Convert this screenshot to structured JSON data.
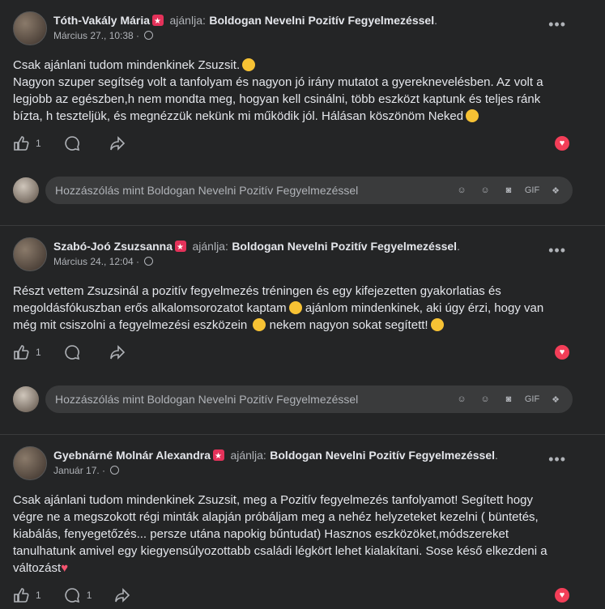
{
  "placeholder": "Hozzászólás mint Boldogan Nevelni Pozitív Fegyelmezéssel",
  "recommends": "ajánlja:",
  "posts": [
    {
      "author": "Tóth-Vakály Mária",
      "page": "Boldogan Nevelni Pozitív Fegyelmezéssel",
      "date": "Március 27., 10:38",
      "body": "Csak ajánlani tudom mindenkinek Zsuzsit.",
      "body2": "Nagyon szuper segítség volt a tanfolyam és nagyon jó irány mutatot a gyereknevelésben. Az volt a legjobb az egészben,h nem mondta meg, hogyan kell csinálni, több eszközt kaptunk és teljes ránk bízta, h teszteljük, és megnézzük nekünk mi működik jól. Hálásan köszönöm Neked",
      "likes": "1",
      "comments": ""
    },
    {
      "author": "Szabó-Joó Zsuzsanna",
      "page": "Boldogan Nevelni Pozitív Fegyelmezéssel",
      "date": "Március 24., 12:04",
      "body": "Részt vettem Zsuzsinál a pozitív fegyelmezés tréningen és egy kifejezetten gyakorlatias és megoldásfókuszban erős alkalomsorozatot kaptam",
      "body2": " ajánlom mindenkinek, aki úgy érzi, hogy van még mit csiszolni a fegyelmezési eszközein ",
      "body3": " nekem nagyon sokat segített!",
      "likes": "1",
      "comments": ""
    },
    {
      "author": "Gyebnárné Molnár Alexandra",
      "page": "Boldogan Nevelni Pozitív Fegyelmezéssel",
      "date": "Január 17.",
      "body": "Csak ajánlani tudom mindenkinek Zsuzsit, meg a Pozitív fegyelmezés tanfolyamot! Segített hogy végre ne a megszokott régi minták alapján próbáljam meg a nehéz helyzeteket kezelni ( büntetés, kiabálás, fenyegetőzés... persze utána napokig bűntudat) Hasznos eszközöket,módszereket tanulhatunk amivel egy kiegyensúlyozottabb családi légkört lehet kialakítani. Sose késő elkezdeni a változást",
      "likes": "1",
      "comments": "1"
    }
  ]
}
